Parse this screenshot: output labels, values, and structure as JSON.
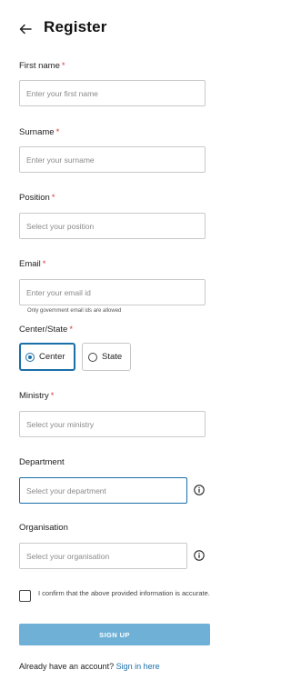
{
  "header": {
    "title": "Register"
  },
  "form": {
    "first_name": {
      "label": "First name",
      "required": "*",
      "placeholder": "Enter your first name"
    },
    "surname": {
      "label": "Surname",
      "required": "*",
      "placeholder": "Enter your surname"
    },
    "position": {
      "label": "Position",
      "required": "*",
      "placeholder": "Select your position"
    },
    "email": {
      "label": "Email",
      "required": "*",
      "placeholder": "Enter your email id",
      "helper": "Only government email ids are allowed"
    },
    "center_state": {
      "label": "Center/State",
      "required": "*",
      "options": [
        "Center",
        "State"
      ],
      "selected": "Center"
    },
    "ministry": {
      "label": "Ministry",
      "required": "*",
      "placeholder": "Select your ministry"
    },
    "department": {
      "label": "Department",
      "placeholder": "Select your department"
    },
    "organisation": {
      "label": "Organisation",
      "placeholder": "Select your organisation"
    },
    "confirm": {
      "text": "I confirm that the above provided information is accurate."
    },
    "submit_label": "SIGN UP"
  },
  "footer": {
    "prompt": "Already have an account?",
    "link": "Sign in here"
  },
  "colors": {
    "accent": "#1b6fa8",
    "button": "#6eb0d6",
    "required": "#d93a3a"
  }
}
